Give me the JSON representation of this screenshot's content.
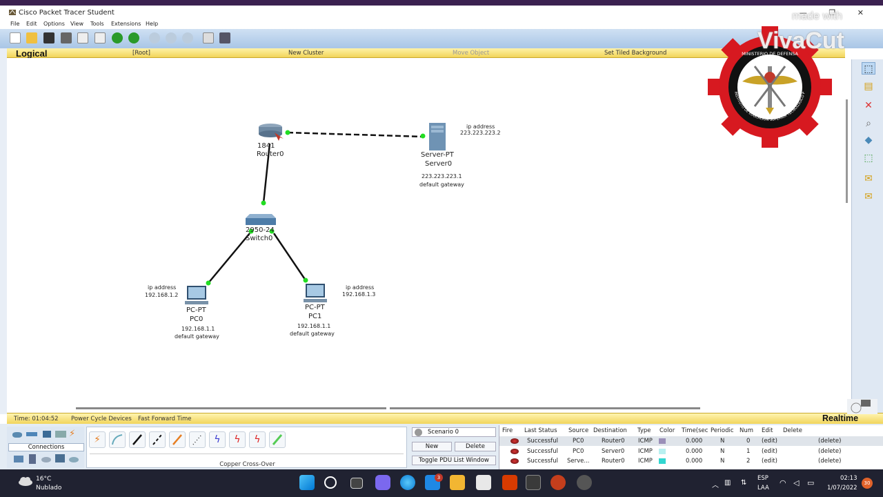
{
  "window": {
    "title": "Cisco Packet Tracer Student",
    "controls": "— ❐ ✕"
  },
  "menu": [
    "File",
    "Edit",
    "Options",
    "View",
    "Tools",
    "Extensions",
    "Help"
  ],
  "workspace_bar": {
    "mode": "Logical",
    "root": "[Root]",
    "new_cluster": "New Cluster",
    "move_object": "Move Object",
    "set_tiled_bg": "Set Tiled Background"
  },
  "devices": {
    "router": {
      "model": "1841",
      "name": "Router0"
    },
    "server": {
      "model": "Server-PT",
      "name": "Server0",
      "gateway": "223.223.223.1",
      "gateway_label": "default gateway",
      "ip_label": "ip address",
      "ip": "223.223.223.2"
    },
    "switch": {
      "model": "2950-24",
      "name": "Switch0"
    },
    "pc0": {
      "model": "PC-PT",
      "name": "PC0",
      "gateway": "192.168.1.1",
      "gateway_label": "default gateway",
      "ip_label": "ip address",
      "ip": "192.168.1.2"
    },
    "pc1": {
      "model": "PC-PT",
      "name": "PC1",
      "gateway": "192.168.1.1",
      "gateway_label": "default gateway",
      "ip_label": "ip address",
      "ip": "192.168.1.3"
    }
  },
  "status": {
    "time": "Time: 01:04:52",
    "power_cycle": "Power Cycle Devices",
    "fast_forward": "Fast Forward Time",
    "mode": "Realtime"
  },
  "bottom": {
    "connections_label": "Connections",
    "cable_label": "Copper Cross-Over",
    "scenario": "Scenario 0",
    "new_btn": "New",
    "delete_btn": "Delete",
    "toggle_btn": "Toggle PDU List Window"
  },
  "pdu": {
    "headers": [
      "Fire",
      "Last Status",
      "Source",
      "Destination",
      "Type",
      "Color",
      "Time(sec)",
      "Periodic",
      "Num",
      "Edit",
      "Delete"
    ],
    "rows": [
      {
        "status": "Successful",
        "source": "PC0",
        "destination": "Router0",
        "type": "ICMP",
        "color": "#9a8fb8",
        "time": "0.000",
        "periodic": "N",
        "num": "0",
        "edit": "(edit)",
        "delete": "(delete)"
      },
      {
        "status": "Successful",
        "source": "PC0",
        "destination": "Server0",
        "type": "ICMP",
        "color": "#b8f0f0",
        "time": "0.000",
        "periodic": "N",
        "num": "1",
        "edit": "(edit)",
        "delete": "(delete)"
      },
      {
        "status": "Successful",
        "source": "Serve...",
        "destination": "Router0",
        "type": "ICMP",
        "color": "#32d6d0",
        "time": "0.000",
        "periodic": "N",
        "num": "2",
        "edit": "(edit)",
        "delete": "(delete)"
      }
    ]
  },
  "taskbar": {
    "temp": "16°C",
    "weather": "Nublado",
    "lang": "ESP",
    "lang2": "LAA",
    "time": "02:13",
    "date": "1/07/2022",
    "badge": "30",
    "mail_badge": "3"
  },
  "watermark": {
    "brand": "VivaCut",
    "made_with": "made with"
  },
  "logo": {
    "top_text": "MINISTERIO DE DEFENSA",
    "ring_text": "INSTITUTO DE EDUCACIÓN SUPERIOR TECNOLÓGICO PÚBLICO DE LAS FUERZAS ARMADAS"
  },
  "colors": {
    "link": "#111111",
    "port_up": "#22dd22",
    "toolbar": "#b8d0ec",
    "status_yellow": "#f5de70"
  }
}
